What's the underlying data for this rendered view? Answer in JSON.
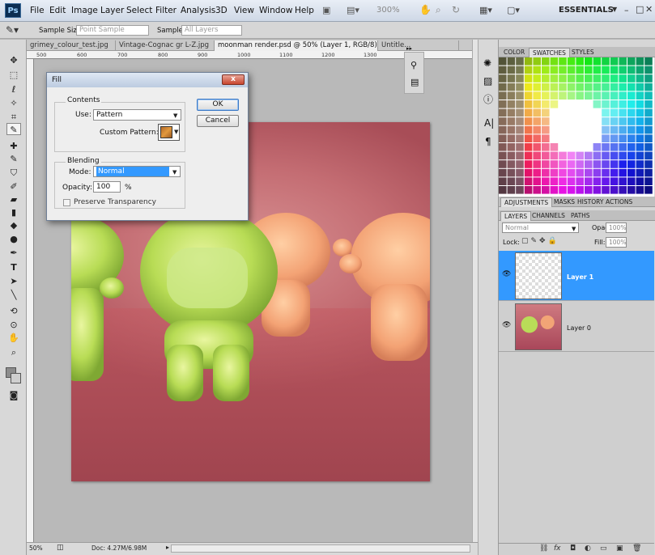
{
  "app": {
    "logo": "Ps",
    "workspace": "ESSENTIALS",
    "zoom_ctrl": "300%"
  },
  "menu": [
    "File",
    "Edit",
    "Image",
    "Layer",
    "Select",
    "Filter",
    "Analysis",
    "3D",
    "View",
    "Window",
    "Help"
  ],
  "options_bar": {
    "sample_size_label": "Sample Size:",
    "sample_size_value": "Point Sample",
    "sample_label": "Sample:",
    "sample_value": "All Layers"
  },
  "tabs": [
    "grimey_colour_test.jpg",
    "Vintage-Cognac gr L-Z.jpg",
    "moonman render.psd @ 50% (Layer 1, RGB/8) *",
    "Untitle..."
  ],
  "ruler": [
    "500",
    "600",
    "700",
    "800",
    "900",
    "1000",
    "1100",
    "1200",
    "1300"
  ],
  "status": {
    "zoom": "50%",
    "doc": "Doc: 4.27M/6.98M"
  },
  "fill_dialog": {
    "title": "Fill",
    "close": "x",
    "contents_label": "Contents",
    "use_label": "Use:",
    "use_value": "Pattern",
    "custom_pattern_label": "Custom Pattern:",
    "blending_label": "Blending",
    "mode_label": "Mode:",
    "mode_value": "Normal",
    "opacity_label": "Opacity:",
    "opacity_value": "100",
    "opacity_unit": "%",
    "preserve_label": "Preserve Transparency",
    "ok_label": "OK",
    "cancel_label": "Cancel"
  },
  "panels": {
    "color_tabs": [
      "COLOR",
      "SWATCHES",
      "STYLES"
    ],
    "adj_tabs": [
      "ADJUSTMENTS",
      "MASKS",
      "HISTORY",
      "ACTIONS"
    ],
    "layers_tabs": [
      "LAYERS",
      "CHANNELS",
      "PATHS"
    ],
    "blend_mode": "Normal",
    "opacity_label": "Opacity:",
    "opacity_value": "100%",
    "lock_label": "Lock:",
    "fill_label": "Fill:",
    "fill_value": "100%",
    "layers": [
      {
        "name": "Layer 1",
        "selected": true
      },
      {
        "name": "Layer 0",
        "selected": false
      }
    ]
  },
  "colors": {
    "accent": "#3399ff",
    "canvas_bg": "#b9b9b9"
  }
}
